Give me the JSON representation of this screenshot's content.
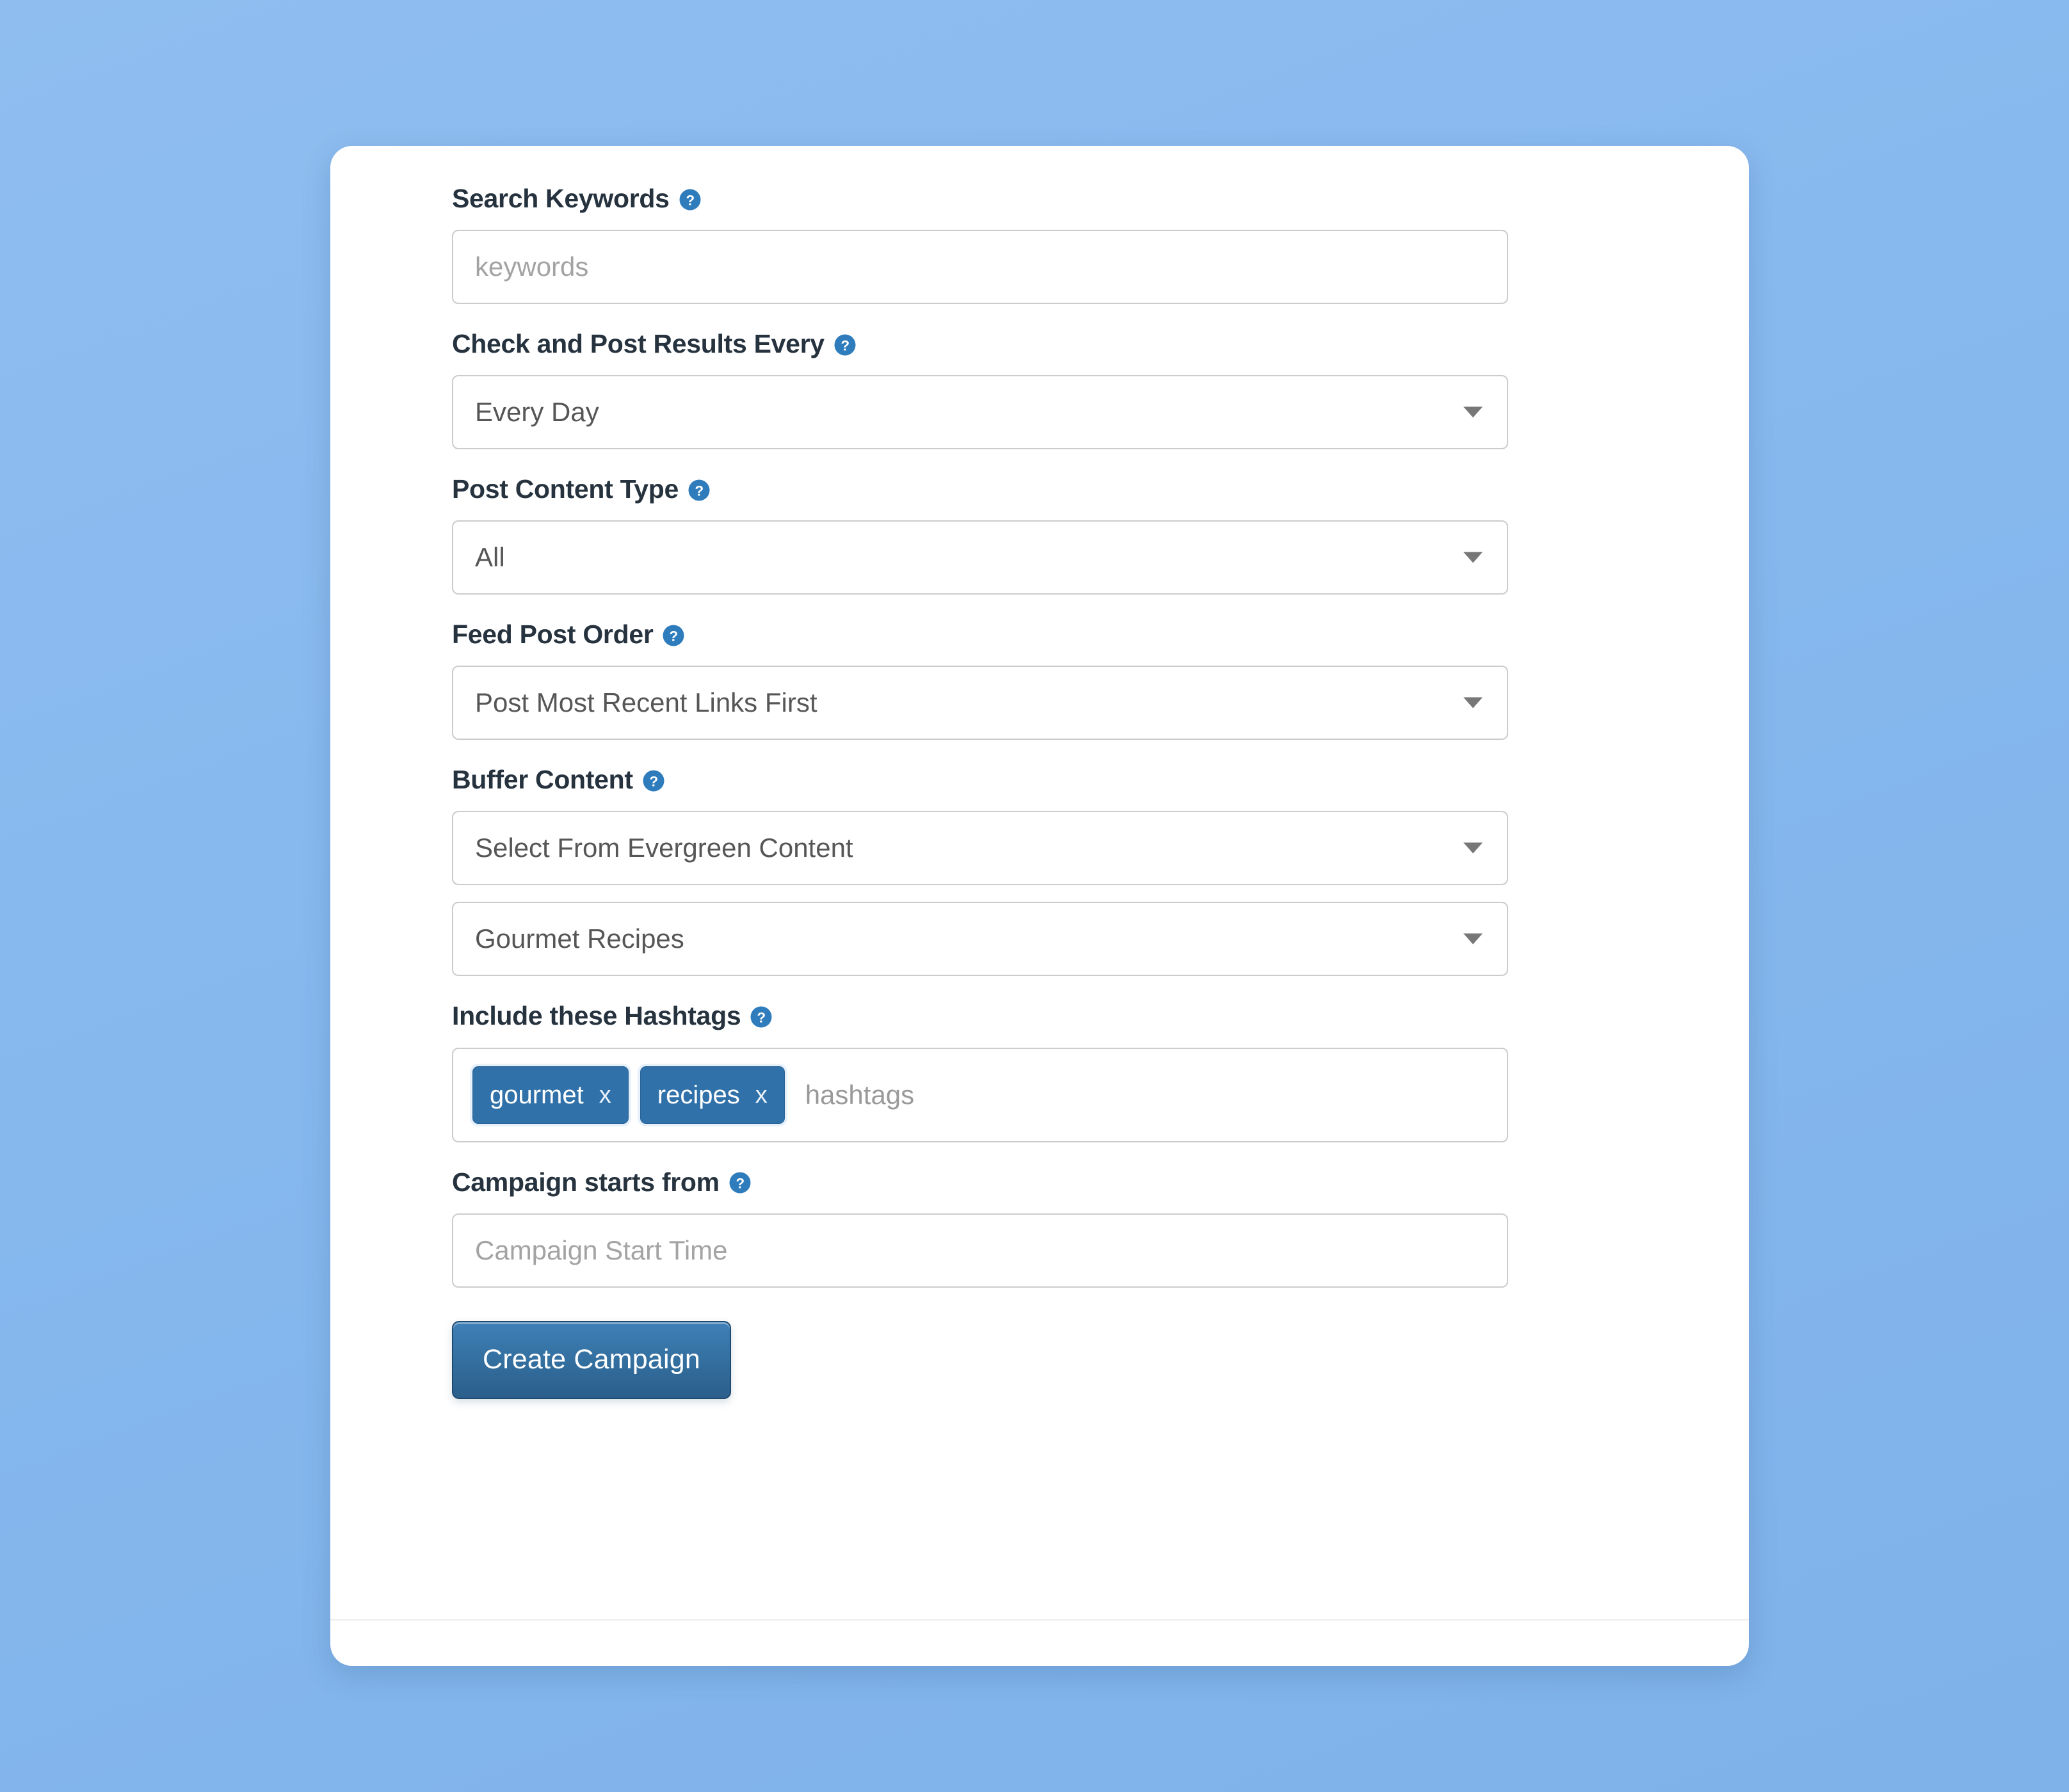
{
  "theme": {
    "page_background": "#86b8ee",
    "card_background": "#ffffff",
    "accent_blue": "#3071a9",
    "button_blue": "#336f9f",
    "label_color": "#26333f",
    "placeholder_color": "#a3a3a3",
    "border_color": "#cccccc"
  },
  "form": {
    "fields": [
      {
        "id": "search-keywords",
        "label": "Search Keywords",
        "help_icon": "question-circle-icon",
        "type": "text",
        "value": "",
        "placeholder": "keywords"
      },
      {
        "id": "check-and-post-results-every",
        "label": "Check and Post Results Every",
        "help_icon": "question-circle-icon",
        "type": "select",
        "value": "Every Day",
        "caret_icon": "chevron-down-icon"
      },
      {
        "id": "post-content-type",
        "label": "Post Content Type",
        "help_icon": "question-circle-icon",
        "type": "select",
        "value": "All",
        "caret_icon": "chevron-down-icon"
      },
      {
        "id": "feed-post-order",
        "label": "Feed Post Order",
        "help_icon": "question-circle-icon",
        "type": "select",
        "value": "Post Most Recent Links First",
        "caret_icon": "chevron-down-icon"
      },
      {
        "id": "buffer-content",
        "label": "Buffer Content",
        "help_icon": "question-circle-icon",
        "type": "select-pair",
        "value": "Select From Evergreen Content",
        "value_secondary": "Gourmet Recipes",
        "caret_icon": "chevron-down-icon"
      },
      {
        "id": "include-these-hashtags",
        "label": "Include these Hashtags",
        "help_icon": "question-circle-icon",
        "type": "tags",
        "tags": [
          {
            "label": "gourmet",
            "remove_label": "x"
          },
          {
            "label": "recipes",
            "remove_label": "x"
          }
        ],
        "placeholder": "hashtags"
      },
      {
        "id": "campaign-starts-from",
        "label": "Campaign starts from",
        "help_icon": "question-circle-icon",
        "type": "text",
        "value": "",
        "placeholder": "Campaign Start Time"
      }
    ],
    "submit_button": {
      "label": "Create Campaign"
    }
  }
}
